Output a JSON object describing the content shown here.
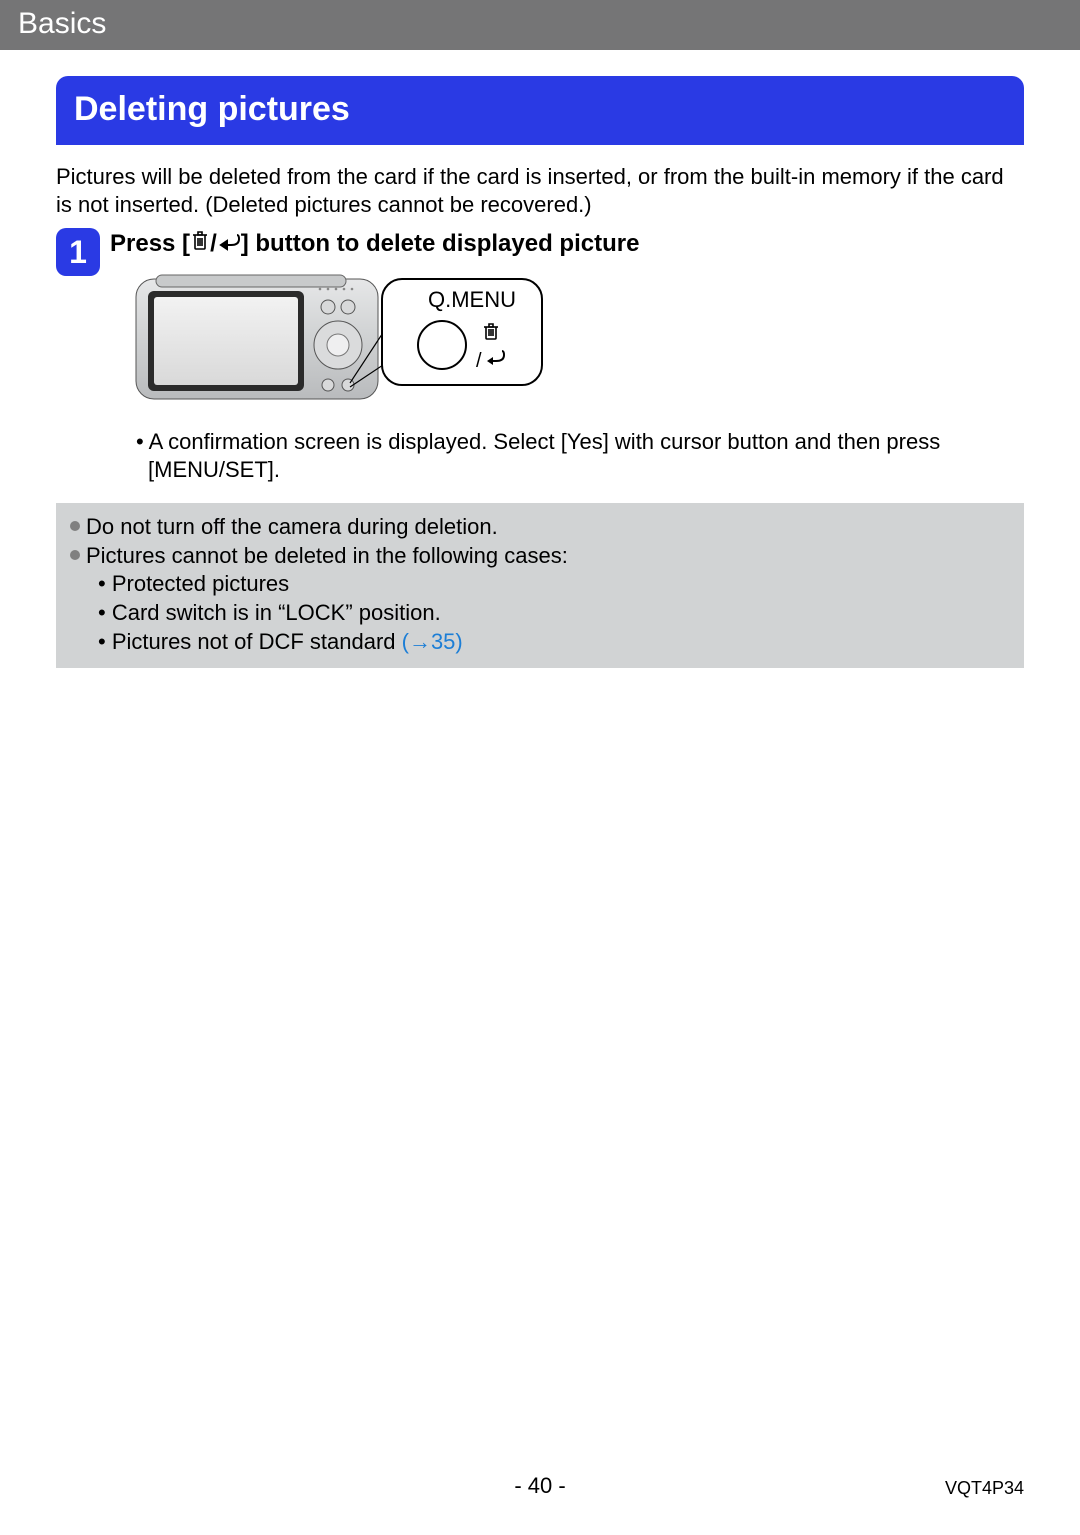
{
  "header": {
    "chapter": "Basics"
  },
  "section": {
    "title": "Deleting pictures"
  },
  "intro": "Pictures will be deleted from the card if the card is inserted, or from the built-in memory if the card is not inserted. (Deleted pictures cannot be recovered.)",
  "step1": {
    "number": "1",
    "heading_prefix": "Press [",
    "heading_mid": " / ",
    "heading_suffix": "] button to delete displayed picture",
    "callout_label": "Q.MENU",
    "confirm_note": "• A confirmation screen is displayed. Select [Yes] with cursor button and then press [MENU/SET]."
  },
  "warnings": {
    "line1": "Do not turn off the camera during deletion.",
    "line2": "Pictures cannot be deleted in the following cases:",
    "sub1": "Protected pictures",
    "sub2": "Card switch is in “LOCK” position.",
    "sub3_prefix": "Pictures not of DCF standard ",
    "sub3_ref": "(→35)"
  },
  "page_number": "- 40 -",
  "doc_code": "VQT4P34",
  "icons": {
    "trash": "trash-icon",
    "return": "return-icon"
  }
}
